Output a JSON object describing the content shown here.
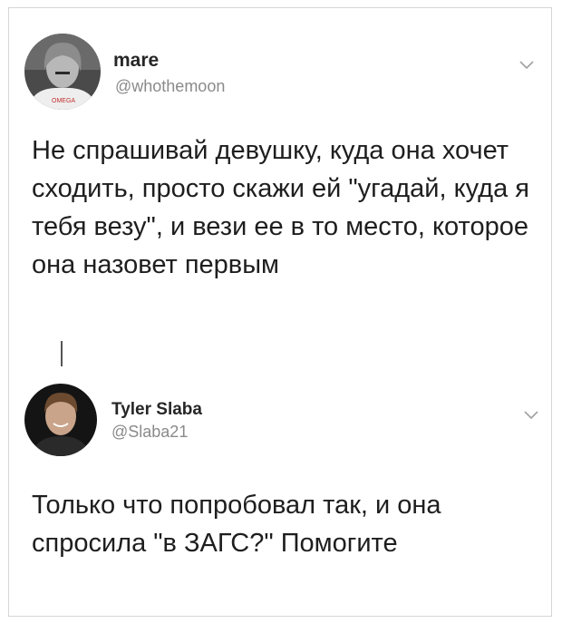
{
  "tweets": [
    {
      "display_name": "mare",
      "handle": "@whothemoon",
      "text": "Не спрашивай девушку, куда она хочет сходить, просто скажи ей \"угадай, куда я тебя везу\", и вези ее в то место, которое она назовет первым",
      "avatar_icon": "user-avatar-photo",
      "menu_icon": "chevron-down-icon"
    },
    {
      "display_name": "Tyler Slaba",
      "handle": "@Slaba21",
      "text": "Только что попробовал так, и она спросила \"в ЗАГС?\" Помогите",
      "avatar_icon": "user-avatar-photo",
      "menu_icon": "chevron-down-icon"
    }
  ],
  "colors": {
    "text": "#1e1e1e",
    "handle": "#8a8a8a",
    "border": "#d6d6d6",
    "thread_line": "#555555"
  }
}
